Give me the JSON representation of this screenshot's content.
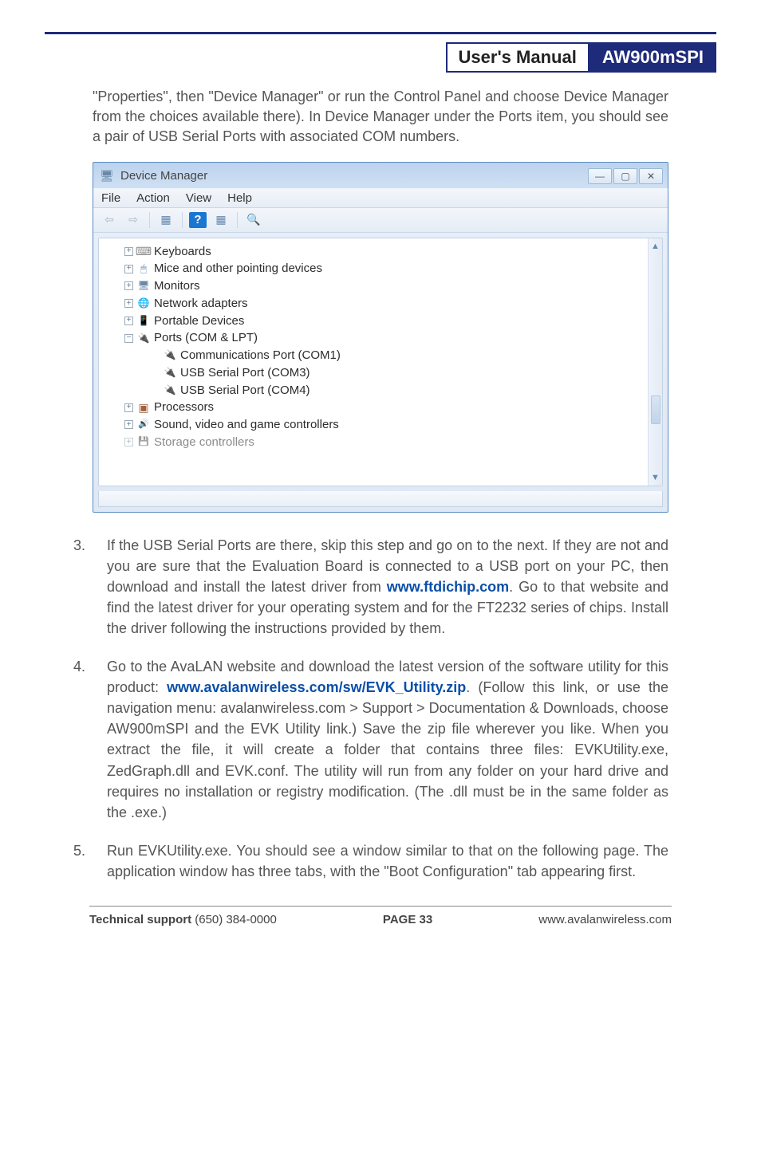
{
  "header": {
    "left": "User's Manual",
    "right": "AW900mSPI"
  },
  "intro_para": "\"Properties\", then \"Device Manager\" or run the Control Panel and choose Device Manager from the choices available there). In Device Manager under the Ports item, you should see a pair of USB Serial Ports with associated COM numbers.",
  "dm": {
    "title": "Device Manager",
    "menu": {
      "file": "File",
      "action": "Action",
      "view": "View",
      "help": "Help"
    },
    "tree": {
      "keyboards": "Keyboards",
      "mice": "Mice and other pointing devices",
      "monitors": "Monitors",
      "network": "Network adapters",
      "portable": "Portable Devices",
      "ports": "Ports (COM & LPT)",
      "com1": "Communications Port (COM1)",
      "com3": "USB Serial Port (COM3)",
      "com4": "USB Serial Port (COM4)",
      "processors": "Processors",
      "sound": "Sound, video and game controllers",
      "storage": "Storage controllers"
    }
  },
  "steps": {
    "s3a": "If the USB Serial Ports are there, skip this step and go on to the next. If they are not and you are sure that the Evaluation Board is connected to a USB port on your PC, then download and install the latest driver from ",
    "s3_link": "www.ftdichip.com",
    "s3b": ". Go to that website and find the latest driver for your operating system and for the FT2232 series of chips. Install the driver following the instructions provided by them.",
    "s4a": "Go to the AvaLAN website and download the latest version of the software utility for this product: ",
    "s4_link": "www.avalanwireless.com/sw/EVK_Utility.zip",
    "s4b": ". (Follow this link, or use the navigation menu: avalanwireless.com > Support > Documentation & Downloads, choose AW900mSPI and the EVK Utility link.) Save the zip file wherever you like. When you extract the file, it will create a folder that contains three files: EVKUtility.exe, ZedGraph.dll and EVK.conf. The utility will run from any folder on your hard drive and requires no installation or registry modification. (The .dll must be in the same folder as the .exe.)",
    "s5": "Run EVKUtility.exe. You should see a window similar to that on the following page. The application window has three tabs, with the \"Boot Configuration\" tab appearing first."
  },
  "footer": {
    "left_label": "Technical support",
    "left_value": " (650) 384-0000",
    "page": "PAGE 33",
    "right": "www.avalanwireless.com"
  }
}
